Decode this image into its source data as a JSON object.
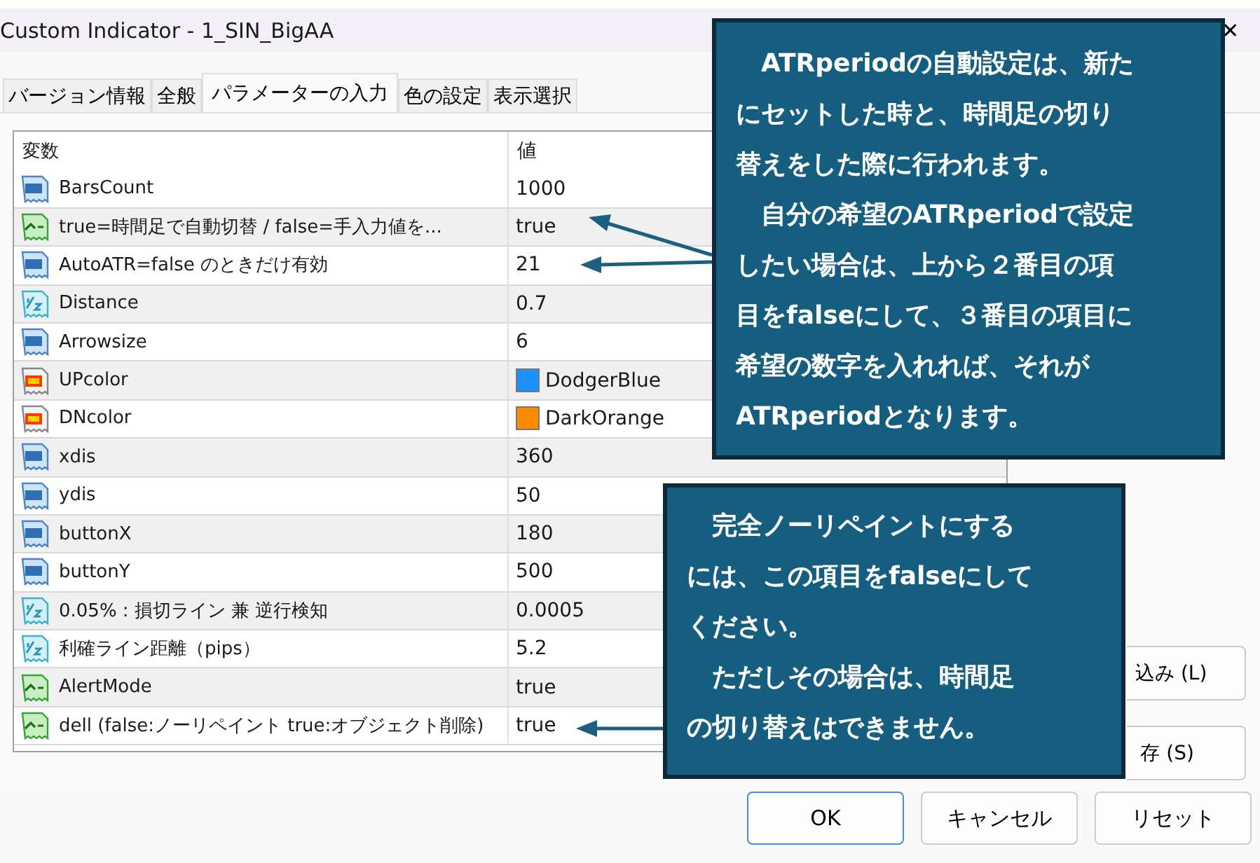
{
  "window": {
    "title": "Custom Indicator - 1_SIN_BigAA",
    "close": "✕"
  },
  "tabs": [
    {
      "label": "バージョン情報",
      "selected": false
    },
    {
      "label": "全般",
      "selected": false
    },
    {
      "label": "パラメーターの入力",
      "selected": true
    },
    {
      "label": "色の設定",
      "selected": false
    },
    {
      "label": "表示選択",
      "selected": false
    }
  ],
  "table": {
    "columns": [
      "変数",
      "値"
    ],
    "rows": [
      {
        "kind": "int",
        "name": "BarsCount",
        "value": "1000"
      },
      {
        "kind": "bool",
        "name": "true=時間足で自動切替 / false=手入力値を...",
        "value": "true"
      },
      {
        "kind": "int",
        "name": "AutoATR=false のときだけ有効",
        "value": "21"
      },
      {
        "kind": "double",
        "name": "Distance",
        "value": "0.7"
      },
      {
        "kind": "int",
        "name": "Arrowsize",
        "value": "6"
      },
      {
        "kind": "color",
        "name": "UPcolor",
        "value": "DodgerBlue",
        "color": "#1e90ff"
      },
      {
        "kind": "color",
        "name": "DNcolor",
        "value": "DarkOrange",
        "color": "#ff8c00"
      },
      {
        "kind": "int",
        "name": "xdis",
        "value": "360"
      },
      {
        "kind": "int",
        "name": "ydis",
        "value": "50"
      },
      {
        "kind": "int",
        "name": "buttonX",
        "value": "180"
      },
      {
        "kind": "int",
        "name": "buttonY",
        "value": "500"
      },
      {
        "kind": "double",
        "name": "0.05% : 損切ライン 兼 逆行検知",
        "value": "0.0005"
      },
      {
        "kind": "double",
        "name": "利確ライン距離（pips）",
        "value": "5.2"
      },
      {
        "kind": "bool",
        "name": "AlertMode",
        "value": "true"
      },
      {
        "kind": "bool",
        "name": "dell (false:ノーリペイント true:オブジェクト削除)",
        "value": "true"
      }
    ]
  },
  "side_buttons": [
    "込み (L)",
    "存 (S)"
  ],
  "buttons": [
    {
      "label": "OK",
      "default": true
    },
    {
      "label": "キャンセル",
      "default": false
    },
    {
      "label": "リセット",
      "default": false
    }
  ],
  "callouts": [
    {
      "lines": [
        "　ATRperiodの自動設定は、新た",
        "にセットした時と、時間足の切り",
        "替えをした際に行われます。",
        "　自分の希望のATRperiodで設定",
        "したい場合は、上から２番目の項",
        "目をfalseにして、３番目の項目に",
        "希望の数字を入れれば、それが",
        "ATRperiodとなります。"
      ]
    },
    {
      "lines": [
        "　完全ノーリペイントにする",
        "には、この項目をfalseにして",
        "ください。",
        "　ただしその場合は、時間足",
        "の切り替えはできません。"
      ]
    }
  ]
}
